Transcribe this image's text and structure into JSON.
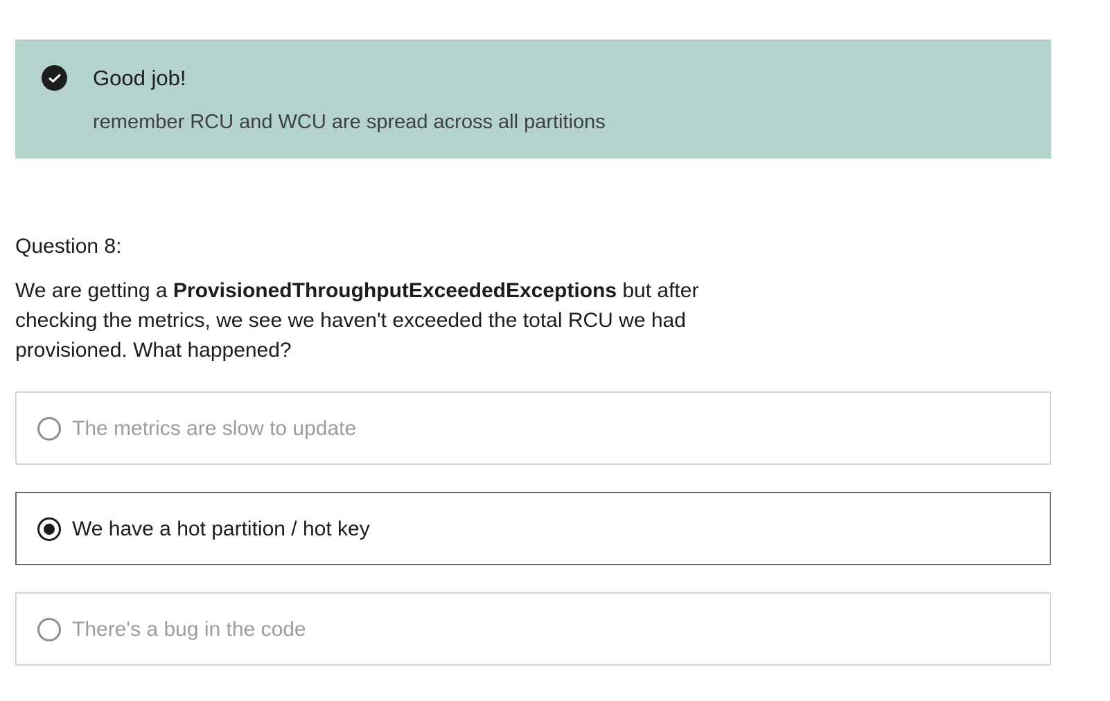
{
  "feedback": {
    "icon": "check-circle-icon",
    "title": "Good job!",
    "message": "remember RCU and WCU are spread across all partitions"
  },
  "question": {
    "label": "Question 8:",
    "text_before": "We are getting a ",
    "text_bold": "ProvisionedThroughputExceededExceptions",
    "text_after": " but after checking the metrics, we see we haven't exceeded the total RCU we had provisioned. What happened?"
  },
  "options": [
    {
      "label": "The metrics are slow to update",
      "selected": false
    },
    {
      "label": "We have a hot partition / hot key",
      "selected": true
    },
    {
      "label": "There's a bug in the code",
      "selected": false
    }
  ],
  "colors": {
    "feedback_background": "#b4d3cd",
    "text_primary": "#1c1d1f",
    "text_muted": "#9a9da0"
  }
}
